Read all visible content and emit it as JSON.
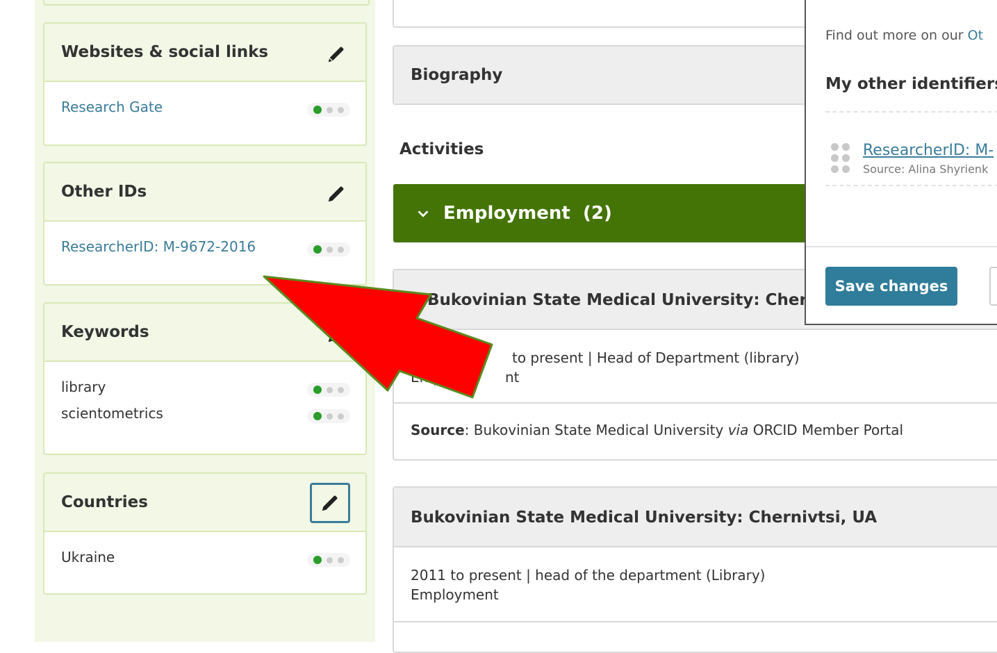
{
  "sidebar": {
    "websites": {
      "title": "Websites & social links",
      "items": [
        {
          "label": "Research Gate"
        }
      ]
    },
    "other_ids": {
      "title": "Other IDs",
      "items": [
        {
          "label": "ResearcherID: M-9672-2016"
        }
      ]
    },
    "keywords": {
      "title": "Keywords",
      "items": [
        {
          "label": "library"
        },
        {
          "label": "scientometrics"
        }
      ]
    },
    "countries": {
      "title": "Countries",
      "items": [
        {
          "label": "Ukraine"
        }
      ]
    }
  },
  "main": {
    "biography_title": "Biography",
    "activities_title": "Activities",
    "employment": {
      "label": "Employment",
      "count": "(2)"
    },
    "entries": [
      {
        "org": "Bukovinian State Medical University: Chernivtsi",
        "dates_role": "to present | Head of Department (library)",
        "type_partial": "Emp",
        "type_partial2": "nt",
        "source_label": "Source",
        "source_text": ": Bukovinian State Medical University ",
        "source_via": "via",
        "source_portal": " ORCID Member Portal"
      },
      {
        "org": "Bukovinian State Medical University: Chernivtsi, UA",
        "dates_role": "2011 to present | head of the department (Library)",
        "type": "Employment"
      }
    ]
  },
  "modal": {
    "find_out_text": "Find out more on our ",
    "find_out_link": "Ot",
    "title": "My other identifiers",
    "identifier": "ResearcherID: M-",
    "source": "Source: Alina Shyrienk",
    "save_label": "Save changes"
  },
  "colors": {
    "sidebar_bg": "#f2f7e6",
    "employment_bar": "#447405",
    "link": "#3a7c9a",
    "save_button": "#2f7d9a",
    "arrow_fill": "#ff0000",
    "arrow_stroke": "#5a8a1e",
    "visibility_on": "#2a9d2a"
  },
  "icons": {
    "edit": "pencil-icon",
    "chevron": "chevron-down-icon",
    "drag": "drag-handle-icon",
    "visibility": "visibility-dots-icon",
    "annotation": "red-arrow"
  }
}
